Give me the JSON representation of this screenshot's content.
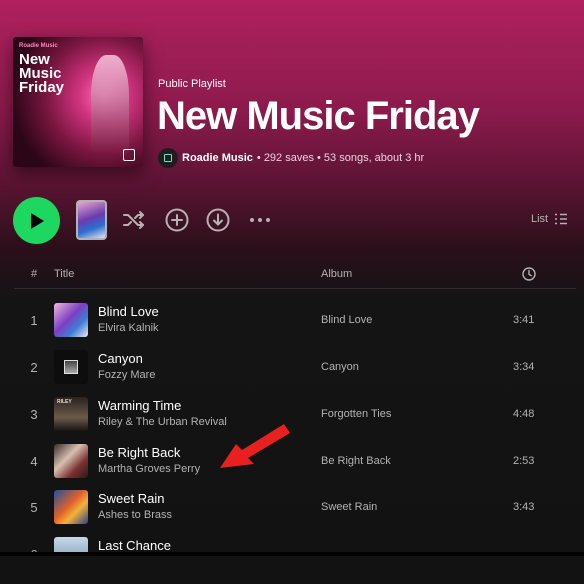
{
  "playlist": {
    "cover": {
      "brand": "Roadie Music",
      "title": "New Music Friday"
    },
    "type": "Public Playlist",
    "title": "New Music Friday",
    "owner": "Roadie Music",
    "stats": "• 292 saves • 53 songs, about 3 hr"
  },
  "actions": {
    "play": "play-icon",
    "shuffle": "shuffle-icon",
    "add": "add-circle-icon",
    "download": "download-icon",
    "more": "more-icon",
    "view_label": "List"
  },
  "table": {
    "headers": {
      "number": "#",
      "title": "Title",
      "album": "Album",
      "duration": "clock-icon"
    },
    "rows": [
      {
        "number": "1",
        "title": "Blind Love",
        "artist": "Elvira Kalnik",
        "album": "Blind Love",
        "duration": "3:41"
      },
      {
        "number": "2",
        "title": "Canyon",
        "artist": "Fozzy Mare",
        "album": "Canyon",
        "duration": "3:34"
      },
      {
        "number": "3",
        "title": "Warming Time",
        "artist": "Riley & The Urban Revival",
        "album": "Forgotten Ties",
        "duration": "4:48",
        "art_text": "RILEY"
      },
      {
        "number": "4",
        "title": "Be Right Back",
        "artist": "Martha Groves Perry",
        "album": "Be Right Back",
        "duration": "2:53"
      },
      {
        "number": "5",
        "title": "Sweet Rain",
        "artist": "Ashes to Brass",
        "album": "Sweet Rain",
        "duration": "3:43"
      },
      {
        "number": "6",
        "title": "Last Chance",
        "artist": "",
        "album": "",
        "duration": ""
      }
    ]
  },
  "colors": {
    "accent": "#1ed760",
    "header": "#b0215f",
    "annotation": "#e8201f"
  }
}
